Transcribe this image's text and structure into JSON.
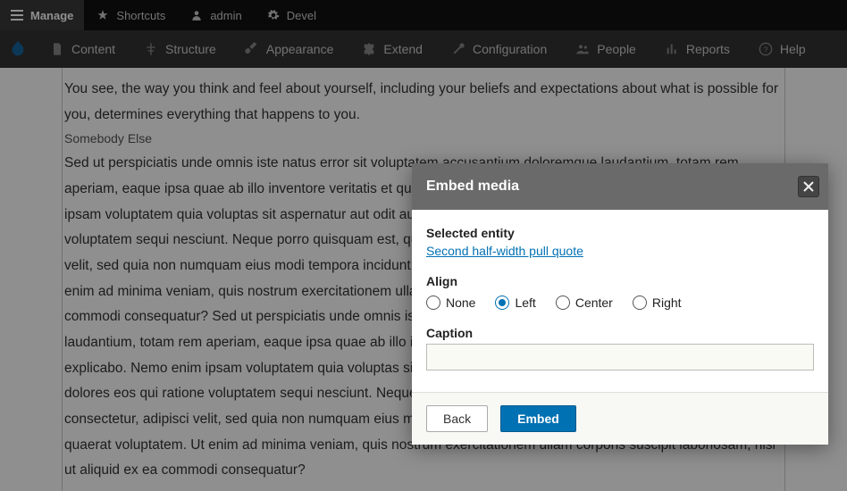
{
  "toolbar": {
    "manage_label": "Manage",
    "shortcuts_label": "Shortcuts",
    "user_label": "admin",
    "devel_label": "Devel"
  },
  "admin_menu": {
    "content": "Content",
    "structure": "Structure",
    "appearance": "Appearance",
    "extend": "Extend",
    "configuration": "Configuration",
    "people": "People",
    "reports": "Reports",
    "help": "Help"
  },
  "article": {
    "para1": "You see, the way you think and feel about yourself, including your beliefs and expectations about what is possible for you, determines everything that happens to you.",
    "citation": "Somebody Else",
    "para2": "Sed ut perspiciatis unde omnis iste natus error sit voluptatem accusantium doloremque laudantium, totam rem aperiam, eaque ipsa quae ab illo inventore veritatis et quasi architecto beatae vitae dicta sunt explicabo. Nemo enim ipsam voluptatem quia voluptas sit aspernatur aut odit aut fugit, sed quia consequuntur magni dolores eos qui ratione voluptatem sequi nesciunt. Neque porro quisquam est, qui dolorem ipsum quia dolor sit amet, consectetur, adipisci velit, sed quia non numquam eius modi tempora incidunt ut labore et dolore magnam aliquam quaerat voluptatem. Ut enim ad minima veniam, quis nostrum exercitationem ullam corporis suscipit laboriosam, nisi ut aliquid ex ea commodi consequatur? Sed ut perspiciatis unde omnis iste natus error sit voluptatem accusantium doloremque laudantium, totam rem aperiam, eaque ipsa quae ab illo inventore veritatis et quasi architecto beatae vitae dicta sunt explicabo. Nemo enim ipsam voluptatem quia voluptas sit aspernatur aut odit aut fugit, sed quia consequuntur magni dolores eos qui ratione voluptatem sequi nesciunt. Neque porro quisquam est, qui dolorem ipsum quia dolor sit amet, consectetur, adipisci velit, sed quia non numquam eius modi tempora incidunt ut labore et dolore magnam aliquam quaerat voluptatem. Ut enim ad minima veniam, quis nostrum exercitationem ullam corporis suscipit laboriosam, nisi ut aliquid ex ea commodi consequatur?"
  },
  "dialog": {
    "title": "Embed media",
    "selected_entity_label": "Selected entity",
    "selected_entity_link": "Second half-width pull quote",
    "align_label": "Align",
    "align_options": {
      "none": "None",
      "left": "Left",
      "center": "Center",
      "right": "Right"
    },
    "align_selected": "left",
    "caption_label": "Caption",
    "caption_value": "",
    "back_label": "Back",
    "embed_label": "Embed"
  }
}
